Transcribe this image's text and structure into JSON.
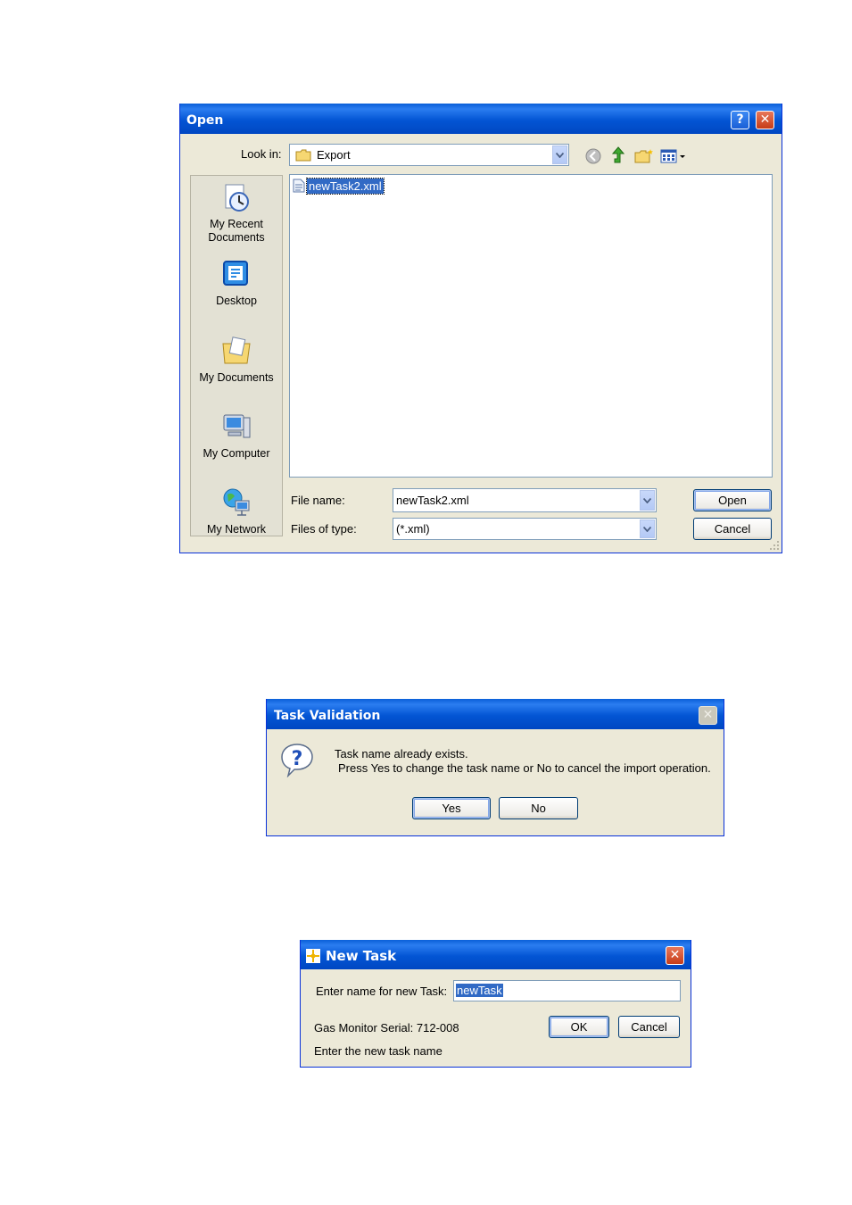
{
  "open_dialog": {
    "title": "Open",
    "look_in_label": "Look in:",
    "look_in_value": "Export",
    "places": [
      {
        "label": "My Recent Documents",
        "icon": "recent-documents-icon"
      },
      {
        "label": "Desktop",
        "icon": "desktop-icon"
      },
      {
        "label": "My Documents",
        "icon": "my-documents-icon"
      },
      {
        "label": "My Computer",
        "icon": "my-computer-icon"
      },
      {
        "label": "My Network",
        "icon": "my-network-icon"
      }
    ],
    "files": [
      {
        "name": "newTask2.xml",
        "selected": true
      }
    ],
    "file_name_label": "File name:",
    "file_name_value": "newTask2.xml",
    "file_type_label": "Files of type:",
    "file_type_value": "(*.xml)",
    "open_button": "Open",
    "cancel_button": "Cancel"
  },
  "task_validation": {
    "title": "Task Validation",
    "message_line1": "Task name already exists.",
    "message_line2": "Press Yes to change the task name or No to cancel the import operation.",
    "yes_button": "Yes",
    "no_button": "No"
  },
  "new_task": {
    "title": "New Task",
    "prompt_label": "Enter name for new Task:",
    "name_value": "newTask",
    "serial_text": "Gas Monitor Serial: 712-008",
    "ok_button": "OK",
    "cancel_button": "Cancel",
    "status_text": "Enter the new task name"
  },
  "colors": {
    "xp_title_blue": "#0355d4",
    "dialog_face": "#ece9d8",
    "selection": "#316ac5"
  }
}
